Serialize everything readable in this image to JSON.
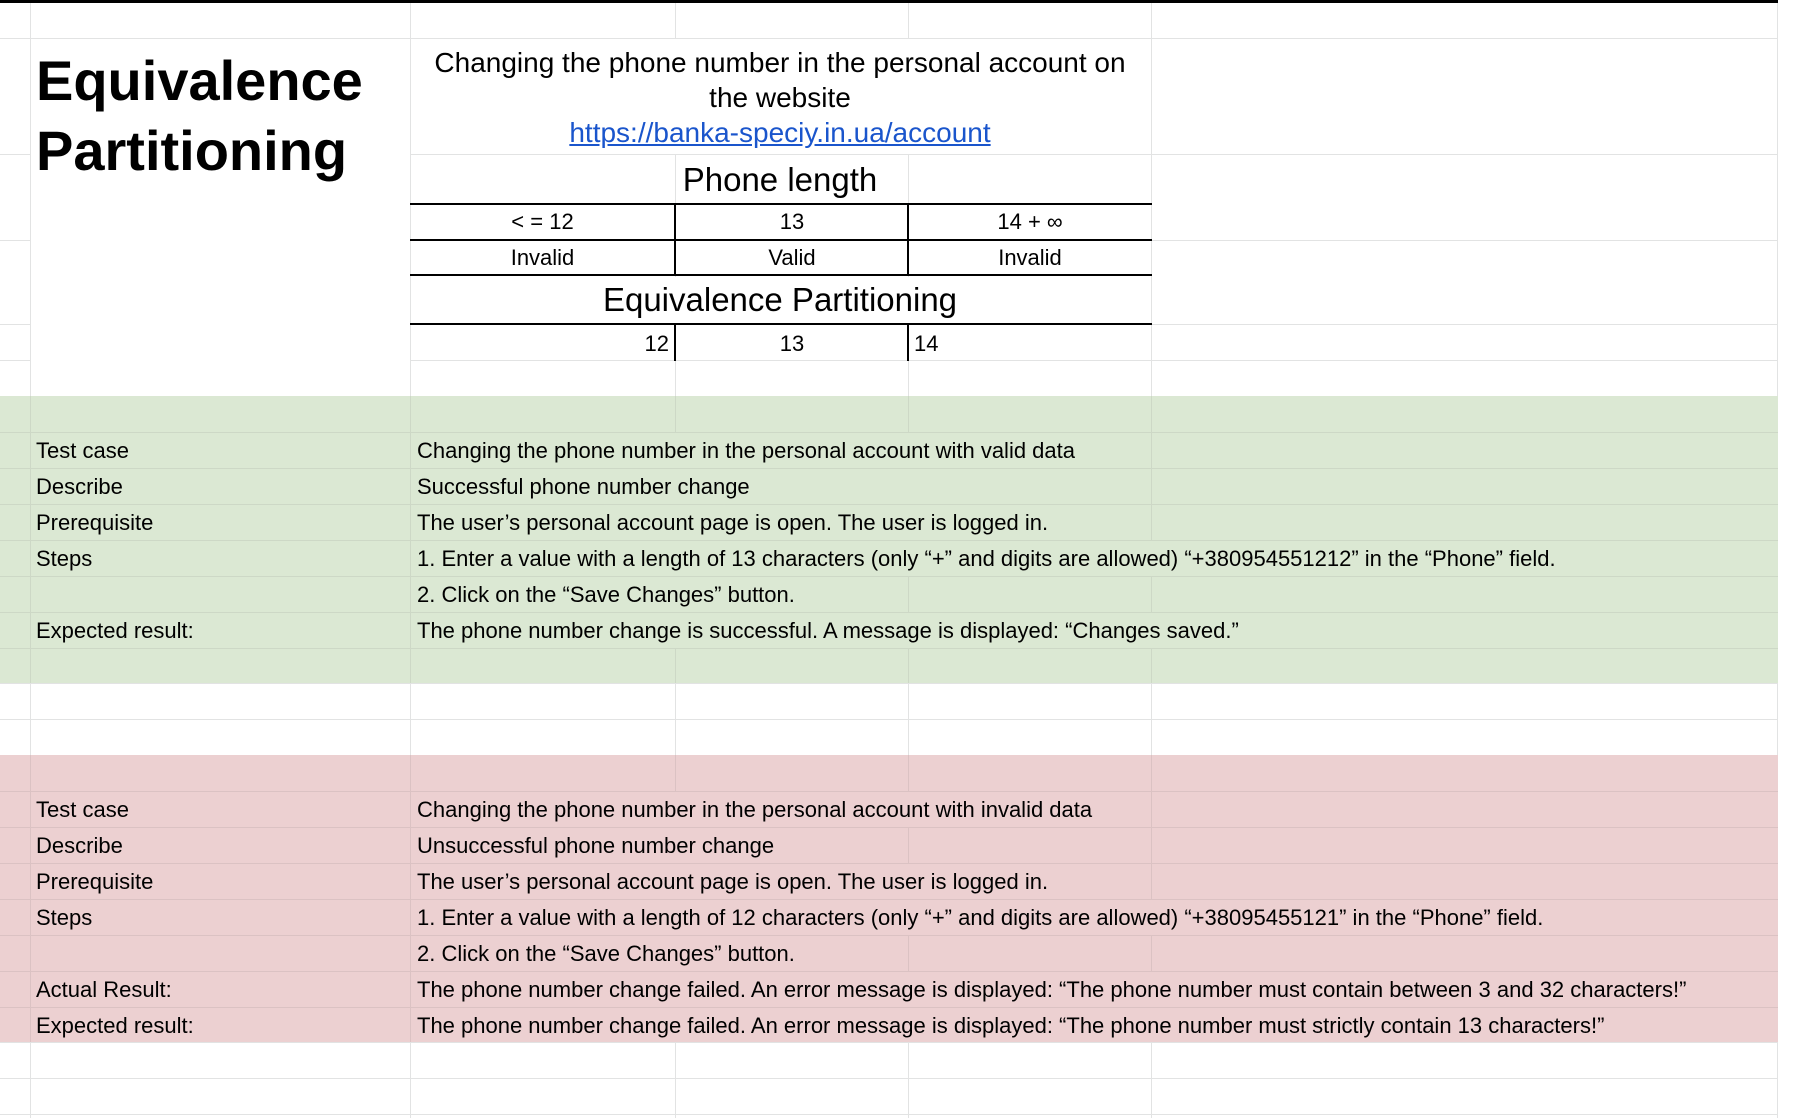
{
  "title": "Equivalence\nPartitioning",
  "header": {
    "line1": "Changing the phone number in the personal account on",
    "line2": "the website",
    "link": "https://banka-speciy.in.ua/account"
  },
  "phone_length": {
    "title": "Phone length",
    "ranges": [
      "< = 12",
      "13",
      "14 + ∞"
    ],
    "validity": [
      "Invalid",
      "Valid",
      "Invalid"
    ]
  },
  "equivalence": {
    "title": "Equivalence Partitioning",
    "values": [
      "12",
      "13",
      "14"
    ]
  },
  "valid_case": {
    "rows": [
      {
        "label": "Test case",
        "value": "Changing the phone number in the personal account with valid data"
      },
      {
        "label": "Describe",
        "value": "Successful phone number change"
      },
      {
        "label": "Prerequisite",
        "value": "The user’s personal account page is open. The user is logged in."
      },
      {
        "label": "Steps",
        "value": "1. Enter a value with a length of 13 characters (only “+” and digits are allowed) “+380954551212” in the “Phone” field."
      },
      {
        "label": "",
        "value": "2. Click on the “Save Changes” button."
      },
      {
        "label": "Expected result:",
        "value": "The phone number change is successful. A message is displayed: “Changes saved.”"
      }
    ]
  },
  "invalid_case": {
    "rows": [
      {
        "label": "Test case",
        "value": "Changing the phone number in the personal account with invalid data"
      },
      {
        "label": "Describe",
        "value": "Unsuccessful phone number change"
      },
      {
        "label": "Prerequisite",
        "value": "The user’s personal account page is open. The user is logged in."
      },
      {
        "label": "Steps",
        "value": "1. Enter a value with a length of 12 characters (only “+” and digits are allowed) “+38095455121” in the “Phone” field."
      },
      {
        "label": "",
        "value": "2. Click on the “Save Changes” button."
      },
      {
        "label": "Actual Result:",
        "value": "The phone number change failed. An error message is displayed: “The phone number must contain between 3 and 32 characters!”"
      },
      {
        "label": "Expected result:",
        "value": "The phone number change failed. An error message is displayed: “The phone number must strictly contain 13 characters!”"
      }
    ]
  }
}
